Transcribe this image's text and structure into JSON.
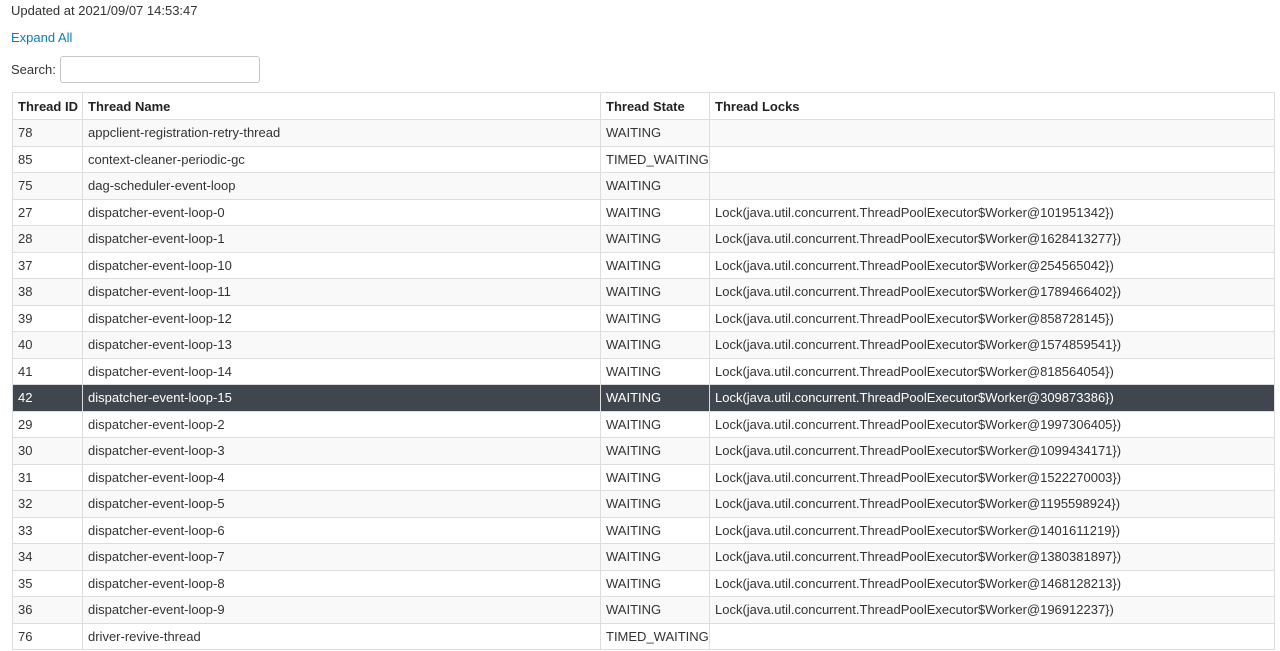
{
  "header": {
    "updated_text": "Updated at 2021/09/07 14:53:47",
    "expand_all_label": "Expand All",
    "search_label": "Search:",
    "search_value": ""
  },
  "table": {
    "columns": [
      "Thread ID",
      "Thread Name",
      "Thread State",
      "Thread Locks"
    ],
    "selected_thread_id": "42",
    "rows": [
      {
        "id": "78",
        "name": "appclient-registration-retry-thread",
        "state": "WAITING",
        "locks": ""
      },
      {
        "id": "85",
        "name": "context-cleaner-periodic-gc",
        "state": "TIMED_WAITING",
        "locks": ""
      },
      {
        "id": "75",
        "name": "dag-scheduler-event-loop",
        "state": "WAITING",
        "locks": ""
      },
      {
        "id": "27",
        "name": "dispatcher-event-loop-0",
        "state": "WAITING",
        "locks": "Lock(java.util.concurrent.ThreadPoolExecutor$Worker@101951342})"
      },
      {
        "id": "28",
        "name": "dispatcher-event-loop-1",
        "state": "WAITING",
        "locks": "Lock(java.util.concurrent.ThreadPoolExecutor$Worker@1628413277})"
      },
      {
        "id": "37",
        "name": "dispatcher-event-loop-10",
        "state": "WAITING",
        "locks": "Lock(java.util.concurrent.ThreadPoolExecutor$Worker@254565042})"
      },
      {
        "id": "38",
        "name": "dispatcher-event-loop-11",
        "state": "WAITING",
        "locks": "Lock(java.util.concurrent.ThreadPoolExecutor$Worker@1789466402})"
      },
      {
        "id": "39",
        "name": "dispatcher-event-loop-12",
        "state": "WAITING",
        "locks": "Lock(java.util.concurrent.ThreadPoolExecutor$Worker@858728145})"
      },
      {
        "id": "40",
        "name": "dispatcher-event-loop-13",
        "state": "WAITING",
        "locks": "Lock(java.util.concurrent.ThreadPoolExecutor$Worker@1574859541})"
      },
      {
        "id": "41",
        "name": "dispatcher-event-loop-14",
        "state": "WAITING",
        "locks": "Lock(java.util.concurrent.ThreadPoolExecutor$Worker@818564054})"
      },
      {
        "id": "42",
        "name": "dispatcher-event-loop-15",
        "state": "WAITING",
        "locks": "Lock(java.util.concurrent.ThreadPoolExecutor$Worker@309873386})"
      },
      {
        "id": "29",
        "name": "dispatcher-event-loop-2",
        "state": "WAITING",
        "locks": "Lock(java.util.concurrent.ThreadPoolExecutor$Worker@1997306405})"
      },
      {
        "id": "30",
        "name": "dispatcher-event-loop-3",
        "state": "WAITING",
        "locks": "Lock(java.util.concurrent.ThreadPoolExecutor$Worker@1099434171})"
      },
      {
        "id": "31",
        "name": "dispatcher-event-loop-4",
        "state": "WAITING",
        "locks": "Lock(java.util.concurrent.ThreadPoolExecutor$Worker@1522270003})"
      },
      {
        "id": "32",
        "name": "dispatcher-event-loop-5",
        "state": "WAITING",
        "locks": "Lock(java.util.concurrent.ThreadPoolExecutor$Worker@1195598924})"
      },
      {
        "id": "33",
        "name": "dispatcher-event-loop-6",
        "state": "WAITING",
        "locks": "Lock(java.util.concurrent.ThreadPoolExecutor$Worker@1401611219})"
      },
      {
        "id": "34",
        "name": "dispatcher-event-loop-7",
        "state": "WAITING",
        "locks": "Lock(java.util.concurrent.ThreadPoolExecutor$Worker@1380381897})"
      },
      {
        "id": "35",
        "name": "dispatcher-event-loop-8",
        "state": "WAITING",
        "locks": "Lock(java.util.concurrent.ThreadPoolExecutor$Worker@1468128213})"
      },
      {
        "id": "36",
        "name": "dispatcher-event-loop-9",
        "state": "WAITING",
        "locks": "Lock(java.util.concurrent.ThreadPoolExecutor$Worker@196912237})"
      },
      {
        "id": "76",
        "name": "driver-revive-thread",
        "state": "TIMED_WAITING",
        "locks": ""
      }
    ]
  },
  "colors": {
    "link": "#0a7cc1",
    "selected_row_bg": "#40464e",
    "selected_row_text": "#ffffff",
    "stripe_bg": "#f9f9f9",
    "border": "#dddddd"
  }
}
